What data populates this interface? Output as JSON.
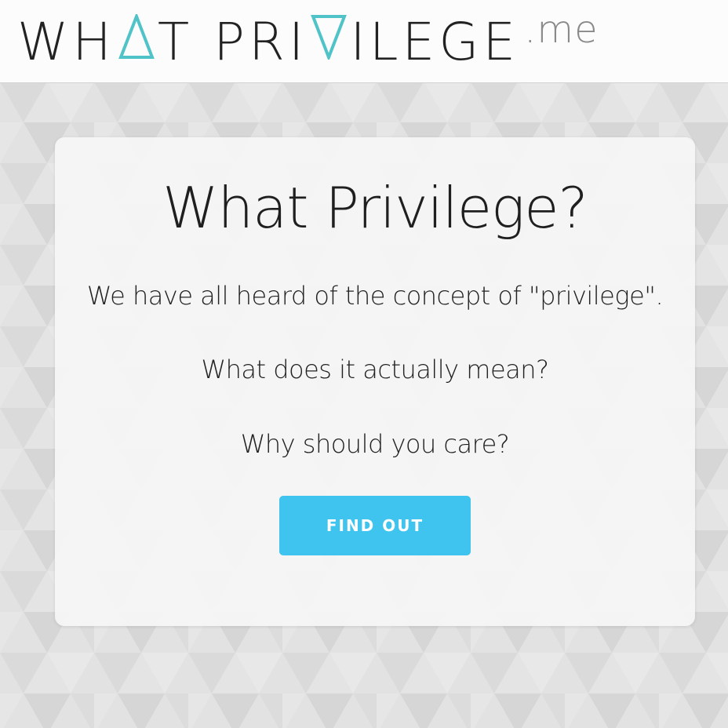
{
  "header": {
    "logo_part1": "WH",
    "logo_part2": "T PRI",
    "logo_part3": "ILEGE",
    "logo_suffix": ".me",
    "logo_accent_color": "#4fc3c7"
  },
  "card": {
    "title": "What Privilege?",
    "line1": "We have all heard of the concept of \"privilege\".",
    "line2": "What does it actually mean?",
    "line3": "Why should you care?",
    "button_label": "FIND OUT",
    "button_color": "#3ec4ee"
  },
  "icons": {
    "logo_a_triangle": "triangle-up-icon",
    "logo_v_triangle": "triangle-down-icon"
  }
}
